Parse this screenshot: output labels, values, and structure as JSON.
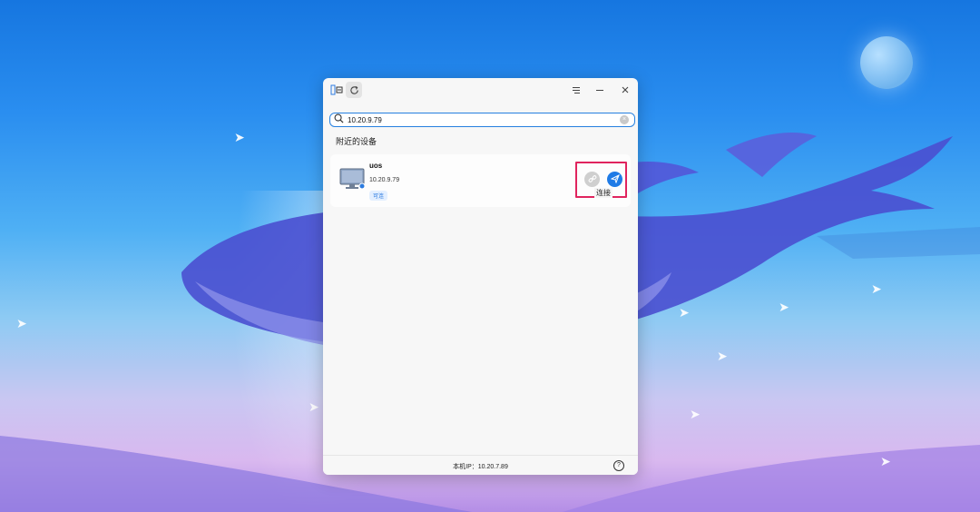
{
  "window": {
    "title_icons": {
      "app": "connect-app-icon",
      "refresh": "refresh-icon",
      "menu": "menu-icon",
      "minimize": "minimize-icon",
      "close": "close-icon"
    }
  },
  "search": {
    "value": "10.20.9.79",
    "icon": "search-icon",
    "clear_icon": "clear-icon"
  },
  "section": {
    "title": "附近的设备"
  },
  "device": {
    "name": "uos",
    "ip": "10.20.9.79",
    "status": "可连",
    "icon": "computer-icon"
  },
  "actions": {
    "connect_icon": "link-icon",
    "send_icon": "send-icon",
    "tooltip": "连接",
    "highlight_color": "#e0245e",
    "accent": "#1f7be6"
  },
  "footer": {
    "local_ip": "本机IP：10.20.7.89",
    "help_icon": "help-icon"
  }
}
